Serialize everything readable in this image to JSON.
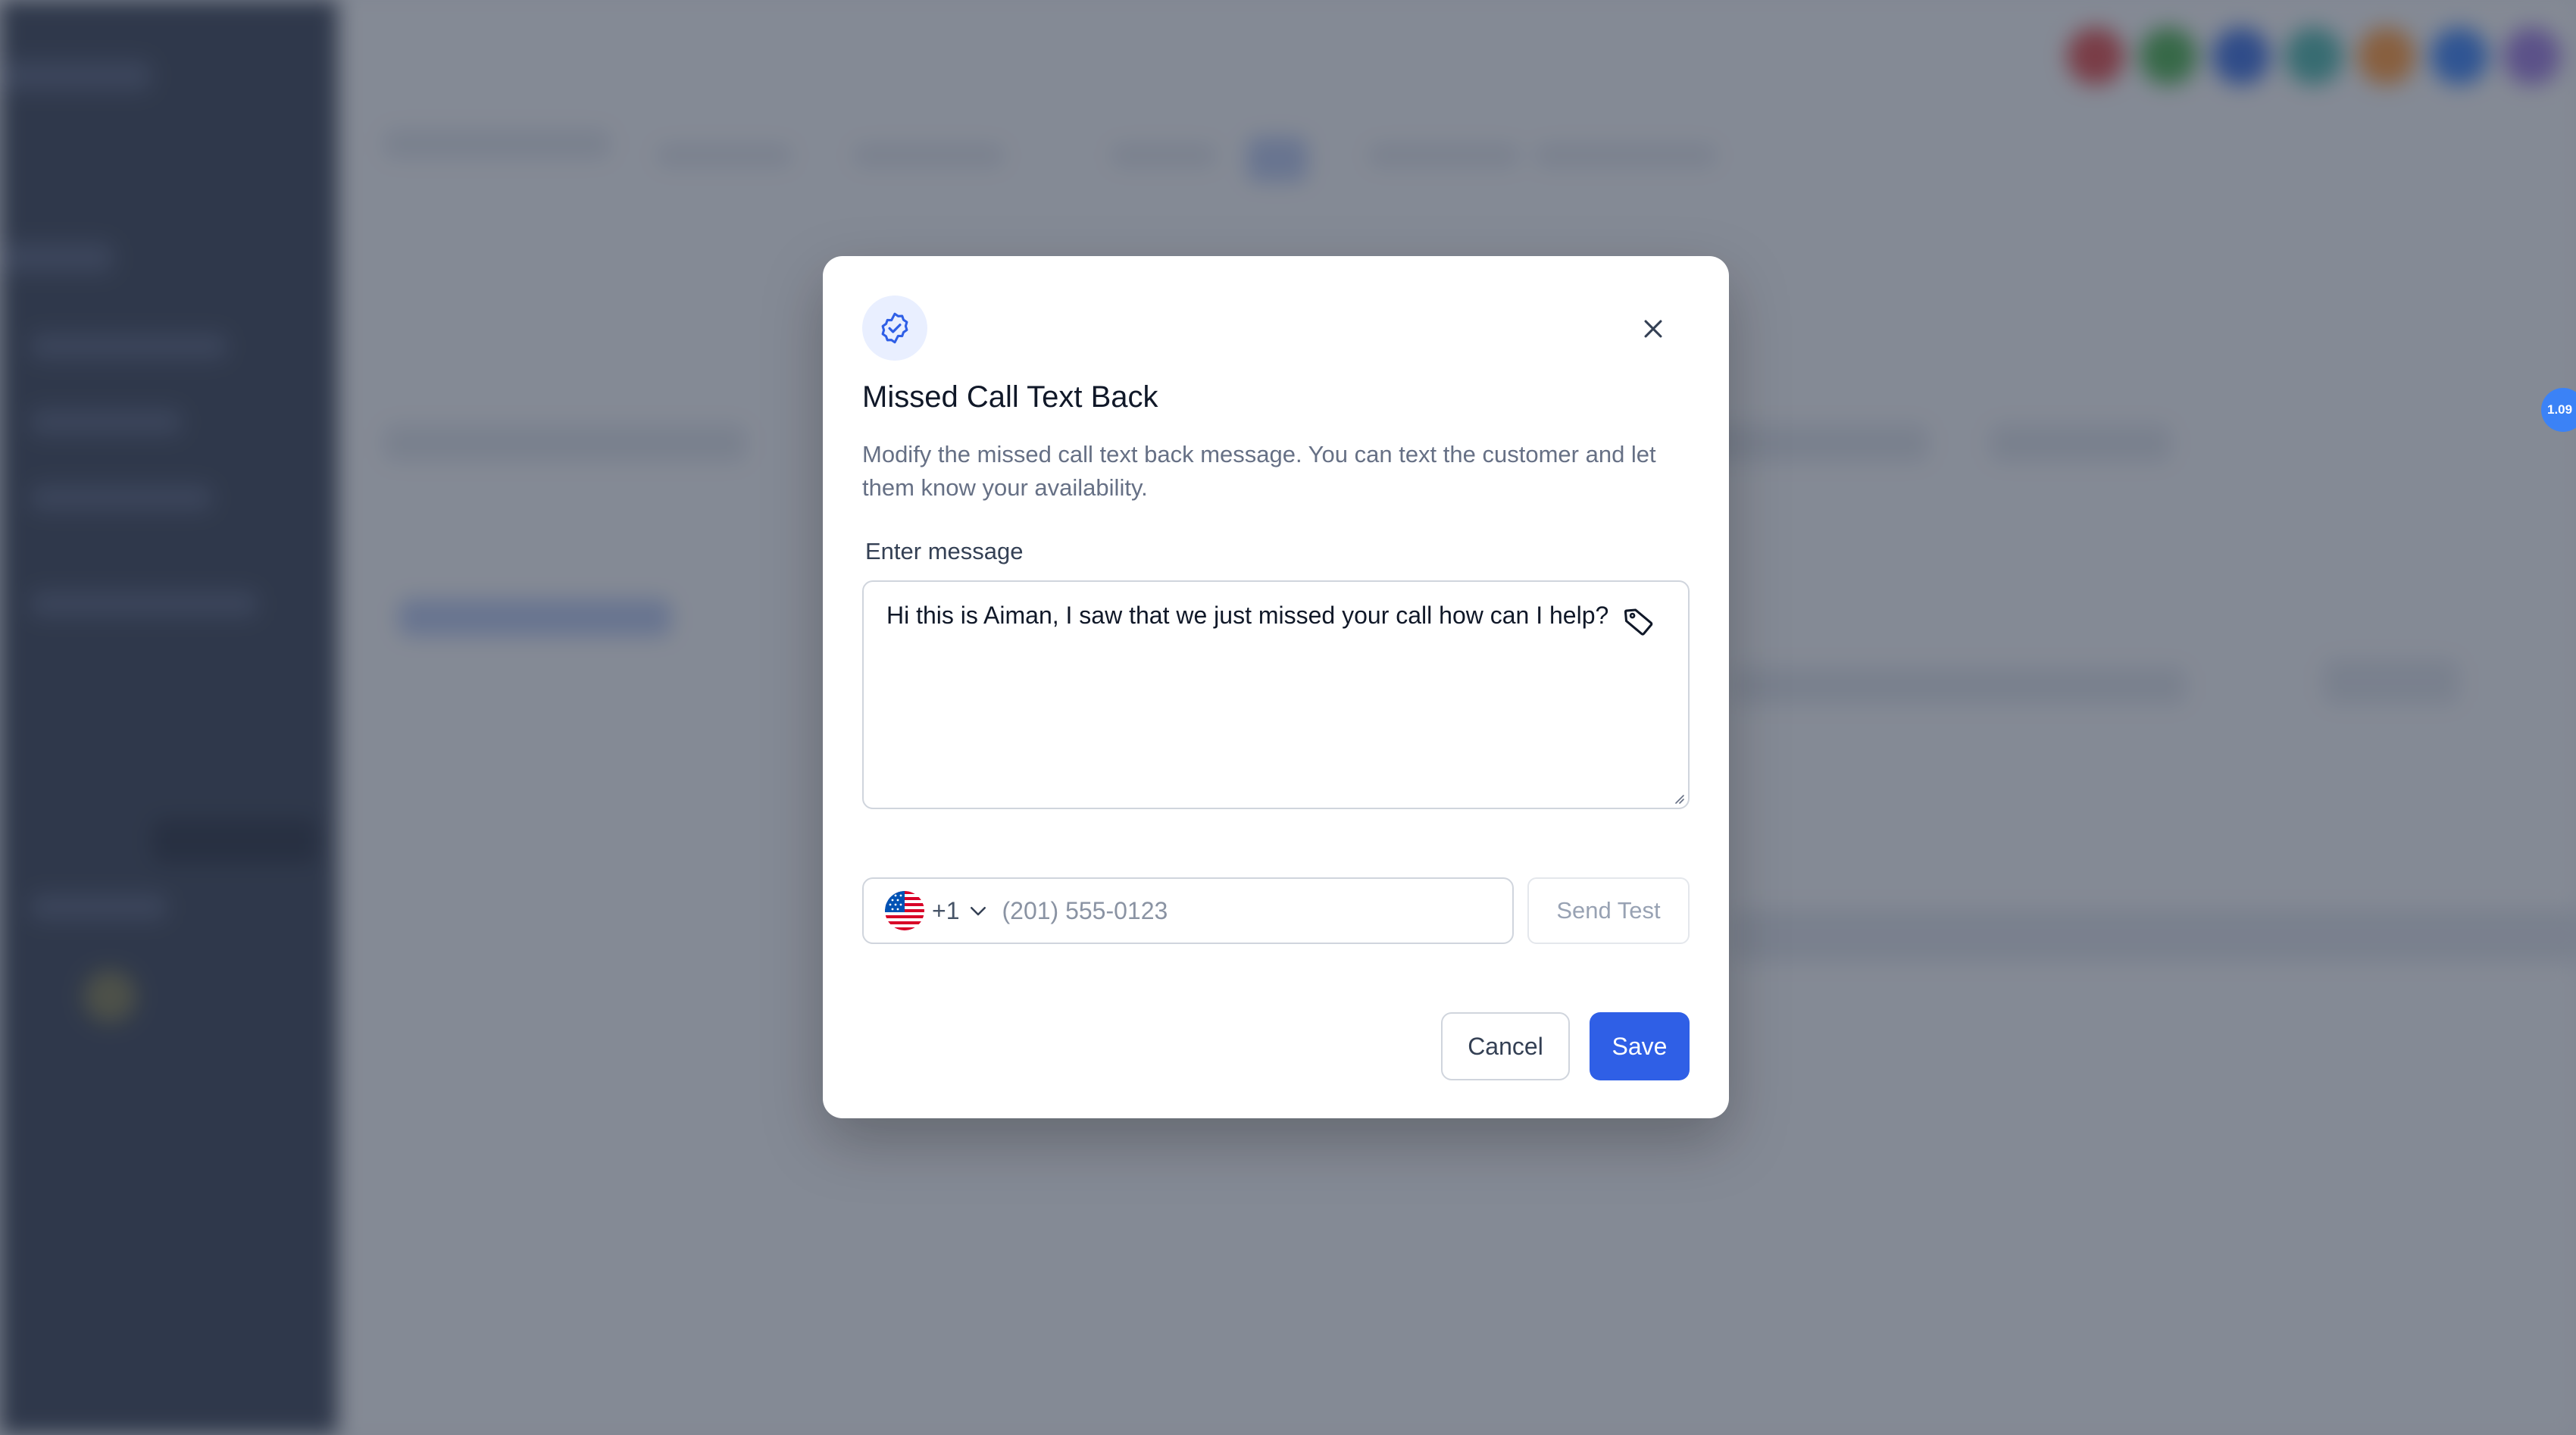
{
  "modal": {
    "title": "Missed Call Text Back",
    "description": "Modify the missed call text back message. You can text the customer and let them know your availability.",
    "message_label": "Enter message",
    "message_value": "Hi this is Aiman, I saw that we just missed your call how can I help?",
    "phone": {
      "dial_code": "+1",
      "placeholder": "(201) 555-0123",
      "country_icon": "us-flag-icon"
    },
    "send_test_label": "Send Test",
    "cancel_label": "Cancel",
    "save_label": "Save",
    "icons": [
      "verified-badge-icon",
      "close-icon",
      "tag-icon",
      "chevron-down-icon"
    ]
  },
  "side_badge": {
    "text": "1.09"
  },
  "colors": {
    "accent": "#2f5fe6",
    "overlay": "#272f42",
    "sidebar": "#3b4457"
  }
}
